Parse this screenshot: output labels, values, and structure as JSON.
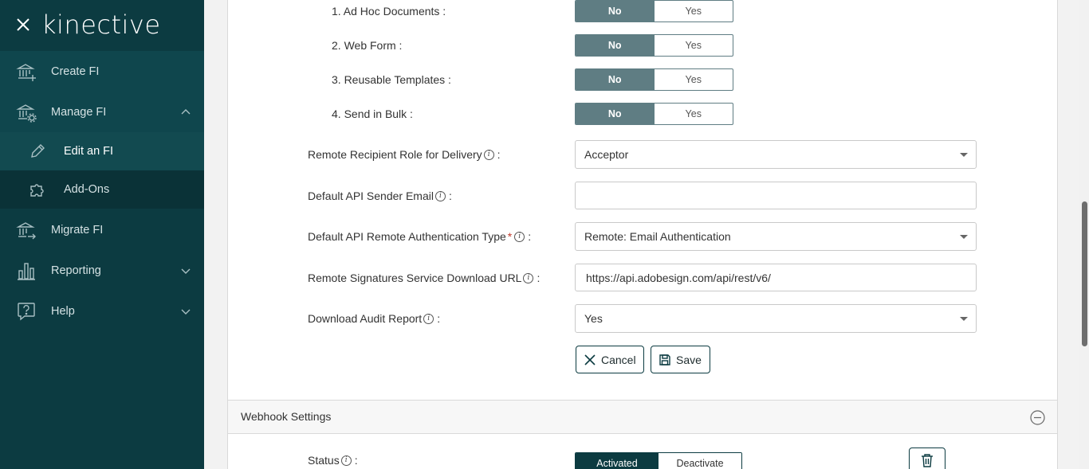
{
  "brand": {
    "name": "kinective"
  },
  "sidebar": {
    "items": [
      {
        "label": "Create FI",
        "icon": "bank-plus-icon"
      },
      {
        "label": "Manage FI",
        "icon": "bank-gear-icon",
        "expanded": true
      },
      {
        "label": "Edit an FI",
        "icon": "pencil-icon",
        "active": true
      },
      {
        "label": "Add-Ons",
        "icon": "puzzle-icon"
      },
      {
        "label": "Migrate FI",
        "icon": "bank-arrow-icon"
      },
      {
        "label": "Reporting",
        "icon": "bar-chart-icon"
      },
      {
        "label": "Help",
        "icon": "question-bubble-icon"
      }
    ]
  },
  "features": [
    {
      "label": "1. Ad Hoc Documents :",
      "no": "No",
      "yes": "Yes",
      "value": "No"
    },
    {
      "label": "2. Web Form :",
      "no": "No",
      "yes": "Yes",
      "value": "No"
    },
    {
      "label": "3. Reusable Templates :",
      "no": "No",
      "yes": "Yes",
      "value": "No"
    },
    {
      "label": "4. Send in Bulk :",
      "no": "No",
      "yes": "Yes",
      "value": "No"
    }
  ],
  "fields": {
    "recipient_role": {
      "label": "Remote Recipient Role for Delivery",
      "colon": ":",
      "value": "Acceptor"
    },
    "sender_email": {
      "label": "Default API Sender Email",
      "colon": ":",
      "value": ""
    },
    "auth_type": {
      "label": "Default API Remote Authentication Type",
      "required": "*",
      "colon": ":",
      "value": "Remote: Email Authentication"
    },
    "download_url": {
      "label": "Remote Signatures Service Download URL",
      "colon": ":",
      "value": "https://api.adobesign.com/api/rest/v6/"
    },
    "audit_report": {
      "label": "Download Audit Report",
      "colon": ":",
      "value": "Yes"
    }
  },
  "actions": {
    "cancel": "Cancel",
    "save": "Save"
  },
  "webhook": {
    "title": "Webhook Settings",
    "status_label": "Status",
    "colon": ":",
    "activated": "Activated",
    "deactivate": "Deactivate",
    "status_value": "Activated"
  },
  "info_glyph": "i",
  "colors": {
    "sidebar": "#0c3b41",
    "toggle_on": "#5f7d83",
    "accent": "#0c3b41",
    "required": "#c0392b"
  }
}
